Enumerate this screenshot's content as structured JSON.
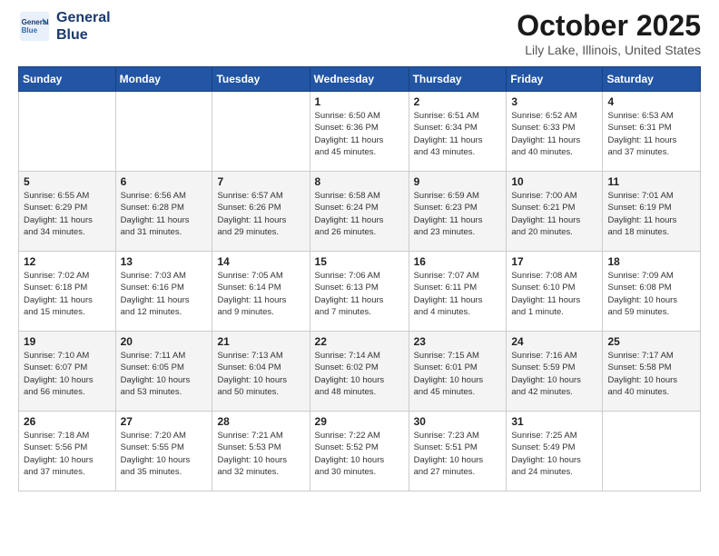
{
  "logo": {
    "line1": "General",
    "line2": "Blue"
  },
  "title": "October 2025",
  "location": "Lily Lake, Illinois, United States",
  "weekdays": [
    "Sunday",
    "Monday",
    "Tuesday",
    "Wednesday",
    "Thursday",
    "Friday",
    "Saturday"
  ],
  "weeks": [
    [
      {
        "day": "",
        "info": ""
      },
      {
        "day": "",
        "info": ""
      },
      {
        "day": "",
        "info": ""
      },
      {
        "day": "1",
        "info": "Sunrise: 6:50 AM\nSunset: 6:36 PM\nDaylight: 11 hours\nand 45 minutes."
      },
      {
        "day": "2",
        "info": "Sunrise: 6:51 AM\nSunset: 6:34 PM\nDaylight: 11 hours\nand 43 minutes."
      },
      {
        "day": "3",
        "info": "Sunrise: 6:52 AM\nSunset: 6:33 PM\nDaylight: 11 hours\nand 40 minutes."
      },
      {
        "day": "4",
        "info": "Sunrise: 6:53 AM\nSunset: 6:31 PM\nDaylight: 11 hours\nand 37 minutes."
      }
    ],
    [
      {
        "day": "5",
        "info": "Sunrise: 6:55 AM\nSunset: 6:29 PM\nDaylight: 11 hours\nand 34 minutes."
      },
      {
        "day": "6",
        "info": "Sunrise: 6:56 AM\nSunset: 6:28 PM\nDaylight: 11 hours\nand 31 minutes."
      },
      {
        "day": "7",
        "info": "Sunrise: 6:57 AM\nSunset: 6:26 PM\nDaylight: 11 hours\nand 29 minutes."
      },
      {
        "day": "8",
        "info": "Sunrise: 6:58 AM\nSunset: 6:24 PM\nDaylight: 11 hours\nand 26 minutes."
      },
      {
        "day": "9",
        "info": "Sunrise: 6:59 AM\nSunset: 6:23 PM\nDaylight: 11 hours\nand 23 minutes."
      },
      {
        "day": "10",
        "info": "Sunrise: 7:00 AM\nSunset: 6:21 PM\nDaylight: 11 hours\nand 20 minutes."
      },
      {
        "day": "11",
        "info": "Sunrise: 7:01 AM\nSunset: 6:19 PM\nDaylight: 11 hours\nand 18 minutes."
      }
    ],
    [
      {
        "day": "12",
        "info": "Sunrise: 7:02 AM\nSunset: 6:18 PM\nDaylight: 11 hours\nand 15 minutes."
      },
      {
        "day": "13",
        "info": "Sunrise: 7:03 AM\nSunset: 6:16 PM\nDaylight: 11 hours\nand 12 minutes."
      },
      {
        "day": "14",
        "info": "Sunrise: 7:05 AM\nSunset: 6:14 PM\nDaylight: 11 hours\nand 9 minutes."
      },
      {
        "day": "15",
        "info": "Sunrise: 7:06 AM\nSunset: 6:13 PM\nDaylight: 11 hours\nand 7 minutes."
      },
      {
        "day": "16",
        "info": "Sunrise: 7:07 AM\nSunset: 6:11 PM\nDaylight: 11 hours\nand 4 minutes."
      },
      {
        "day": "17",
        "info": "Sunrise: 7:08 AM\nSunset: 6:10 PM\nDaylight: 11 hours\nand 1 minute."
      },
      {
        "day": "18",
        "info": "Sunrise: 7:09 AM\nSunset: 6:08 PM\nDaylight: 10 hours\nand 59 minutes."
      }
    ],
    [
      {
        "day": "19",
        "info": "Sunrise: 7:10 AM\nSunset: 6:07 PM\nDaylight: 10 hours\nand 56 minutes."
      },
      {
        "day": "20",
        "info": "Sunrise: 7:11 AM\nSunset: 6:05 PM\nDaylight: 10 hours\nand 53 minutes."
      },
      {
        "day": "21",
        "info": "Sunrise: 7:13 AM\nSunset: 6:04 PM\nDaylight: 10 hours\nand 50 minutes."
      },
      {
        "day": "22",
        "info": "Sunrise: 7:14 AM\nSunset: 6:02 PM\nDaylight: 10 hours\nand 48 minutes."
      },
      {
        "day": "23",
        "info": "Sunrise: 7:15 AM\nSunset: 6:01 PM\nDaylight: 10 hours\nand 45 minutes."
      },
      {
        "day": "24",
        "info": "Sunrise: 7:16 AM\nSunset: 5:59 PM\nDaylight: 10 hours\nand 42 minutes."
      },
      {
        "day": "25",
        "info": "Sunrise: 7:17 AM\nSunset: 5:58 PM\nDaylight: 10 hours\nand 40 minutes."
      }
    ],
    [
      {
        "day": "26",
        "info": "Sunrise: 7:18 AM\nSunset: 5:56 PM\nDaylight: 10 hours\nand 37 minutes."
      },
      {
        "day": "27",
        "info": "Sunrise: 7:20 AM\nSunset: 5:55 PM\nDaylight: 10 hours\nand 35 minutes."
      },
      {
        "day": "28",
        "info": "Sunrise: 7:21 AM\nSunset: 5:53 PM\nDaylight: 10 hours\nand 32 minutes."
      },
      {
        "day": "29",
        "info": "Sunrise: 7:22 AM\nSunset: 5:52 PM\nDaylight: 10 hours\nand 30 minutes."
      },
      {
        "day": "30",
        "info": "Sunrise: 7:23 AM\nSunset: 5:51 PM\nDaylight: 10 hours\nand 27 minutes."
      },
      {
        "day": "31",
        "info": "Sunrise: 7:25 AM\nSunset: 5:49 PM\nDaylight: 10 hours\nand 24 minutes."
      },
      {
        "day": "",
        "info": ""
      }
    ]
  ]
}
